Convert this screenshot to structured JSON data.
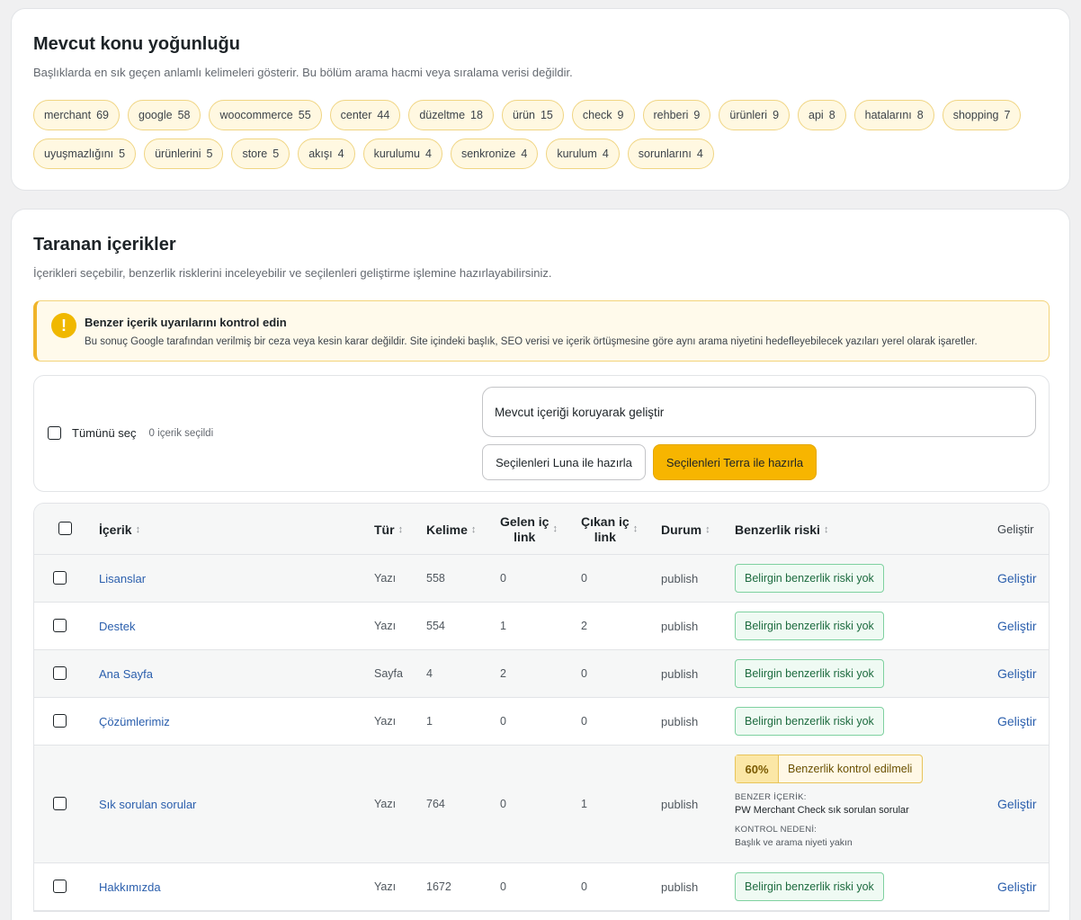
{
  "density": {
    "title": "Mevcut konu yoğunluğu",
    "description": "Başlıklarda en sık geçen anlamlı kelimeleri gösterir. Bu bölüm arama hacmi veya sıralama verisi değildir.",
    "chips_row1": [
      {
        "word": "merchant",
        "count": "69"
      },
      {
        "word": "google",
        "count": "58"
      },
      {
        "word": "woocommerce",
        "count": "55"
      },
      {
        "word": "center",
        "count": "44"
      },
      {
        "word": "düzeltme",
        "count": "18"
      },
      {
        "word": "ürün",
        "count": "15"
      },
      {
        "word": "check",
        "count": "9"
      },
      {
        "word": "rehberi",
        "count": "9"
      },
      {
        "word": "ürünleri",
        "count": "9"
      },
      {
        "word": "api",
        "count": "8"
      },
      {
        "word": "hatalarını",
        "count": "8"
      },
      {
        "word": "shopping",
        "count": "7"
      }
    ],
    "chips_row2": [
      {
        "word": "uyuşmazlığını",
        "count": "5"
      },
      {
        "word": "ürünlerini",
        "count": "5"
      },
      {
        "word": "store",
        "count": "5"
      },
      {
        "word": "akışı",
        "count": "4"
      },
      {
        "word": "kurulumu",
        "count": "4"
      },
      {
        "word": "senkronize",
        "count": "4"
      },
      {
        "word": "kurulum",
        "count": "4"
      },
      {
        "word": "sorunlarını",
        "count": "4"
      }
    ]
  },
  "scanned": {
    "title": "Taranan içerikler",
    "description": "İçerikleri seçebilir, benzerlik risklerini inceleyebilir ve seçilenleri geliştirme işlemine hazırlayabilirsiniz.",
    "notice": {
      "icon": "!",
      "title": "Benzer içerik uyarılarını kontrol edin",
      "text": "Bu sonuç Google tarafından verilmiş bir ceza veya kesin karar değildir. Site içindeki başlık, SEO verisi ve içerik örtüşmesine göre aynı arama niyetini hedefleyebilecek yazıları yerel olarak işaretler."
    },
    "actions": {
      "select_all": "Tümünü seç",
      "selected_count": "0 içerik seçildi",
      "prompt_value": "Mevcut içeriği koruyarak geliştir",
      "luna_button": "Seçilenleri Luna ile hazırla",
      "terra_button": "Seçilenleri Terra ile hazırla"
    },
    "table": {
      "headers": {
        "content": "İçerik",
        "type": "Tür",
        "words": "Kelime",
        "incoming_1": "Gelen iç",
        "incoming_2": "link",
        "outgoing_1": "Çıkan iç",
        "outgoing_2": "link",
        "status": "Durum",
        "risk": "Benzerlik riski",
        "develop": "Geliştir",
        "sort_glyph": "↕"
      },
      "rows": [
        {
          "title": "Lisanslar",
          "type": "Yazı",
          "words": "558",
          "incoming": "0",
          "outgoing": "0",
          "status": "publish",
          "risk": "Belirgin benzerlik riski yok",
          "action": "Geliştir"
        },
        {
          "title": "Destek",
          "type": "Yazı",
          "words": "554",
          "incoming": "1",
          "outgoing": "2",
          "status": "publish",
          "risk": "Belirgin benzerlik riski yok",
          "action": "Geliştir"
        },
        {
          "title": "Ana Sayfa",
          "type": "Sayfa",
          "words": "4",
          "incoming": "2",
          "outgoing": "0",
          "status": "publish",
          "risk": "Belirgin benzerlik riski yok",
          "action": "Geliştir"
        },
        {
          "title": "Çözümlerimiz",
          "type": "Yazı",
          "words": "1",
          "incoming": "0",
          "outgoing": "0",
          "status": "publish",
          "risk": "Belirgin benzerlik riski yok",
          "action": "Geliştir"
        },
        {
          "title": "Sık sorulan sorular",
          "type": "Yazı",
          "words": "764",
          "incoming": "0",
          "outgoing": "1",
          "status": "publish",
          "risk_percent": "60%",
          "risk_label": "Benzerlik kontrol edilmeli",
          "similar_key": "BENZER İÇERİK:",
          "similar_value": "PW Merchant Check sık sorulan sorular",
          "reason_key": "KONTROL NEDENİ:",
          "reason_value": "Başlık ve arama niyeti yakın",
          "action": "Geliştir"
        },
        {
          "title": "Hakkımızda",
          "type": "Yazı",
          "words": "1672",
          "incoming": "0",
          "outgoing": "0",
          "status": "publish",
          "risk": "Belirgin benzerlik riski yok",
          "action": "Geliştir"
        }
      ]
    }
  },
  "colors": {
    "chip_bg": "#fff8e1",
    "accent_button": "#f7b500",
    "link": "#2b5fad",
    "ok_badge_border": "#7fd1a0",
    "warn_badge_border": "#e8c45a"
  }
}
